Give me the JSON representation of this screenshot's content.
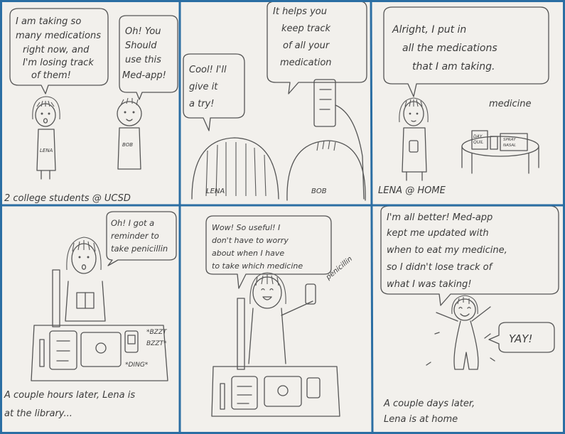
{
  "colors": {
    "panel_border": "#2b6ea3",
    "paper": "#f2f0ec",
    "pencil": "#555555"
  },
  "panels": [
    {
      "id": "p1",
      "speech": [
        "I am taking so",
        "many medications",
        "right now, and",
        "I'm losing track",
        "of them!"
      ],
      "speech2": [
        "Oh! You",
        "Should",
        "use this",
        "Med-app!"
      ],
      "shirt1": "LENA",
      "shirt2": "BOB",
      "caption": "2 college students @ UCSD"
    },
    {
      "id": "p2",
      "speech": [
        "Cool! I'll",
        "give it",
        "a try!"
      ],
      "speech2": [
        "It helps you",
        "keep track",
        "of all your",
        "medication"
      ],
      "label1": "LENA",
      "label2": "BOB"
    },
    {
      "id": "p3",
      "speech": [
        "Alright, I put in",
        "all the medications",
        "that I am taking."
      ],
      "note": "medicine",
      "box1": [
        "DAY",
        "QUIL"
      ],
      "box2": [
        "SPRAY",
        "NASAL"
      ],
      "caption": "LENA @ HOME"
    },
    {
      "id": "p4",
      "speech": [
        "Oh! I got a",
        "reminder to",
        "take penicillin"
      ],
      "sfx1": [
        "*BZZT",
        "BZZT*"
      ],
      "sfx2": "*DING*",
      "caption": [
        "A couple hours later, Lena is",
        "at the library..."
      ]
    },
    {
      "id": "p5",
      "speech": [
        "Wow! So useful! I",
        "don't have to worry",
        "about when I have",
        "to take which medicine"
      ],
      "note": "penicillin"
    },
    {
      "id": "p6",
      "speech": [
        "I'm all better! Med-app",
        "kept me updated with",
        "when to eat my medicine,",
        "so I didn't lose track of",
        "what I was taking!"
      ],
      "yay": "YAY!",
      "caption": [
        "A couple days later,",
        "Lena is at home"
      ]
    }
  ]
}
